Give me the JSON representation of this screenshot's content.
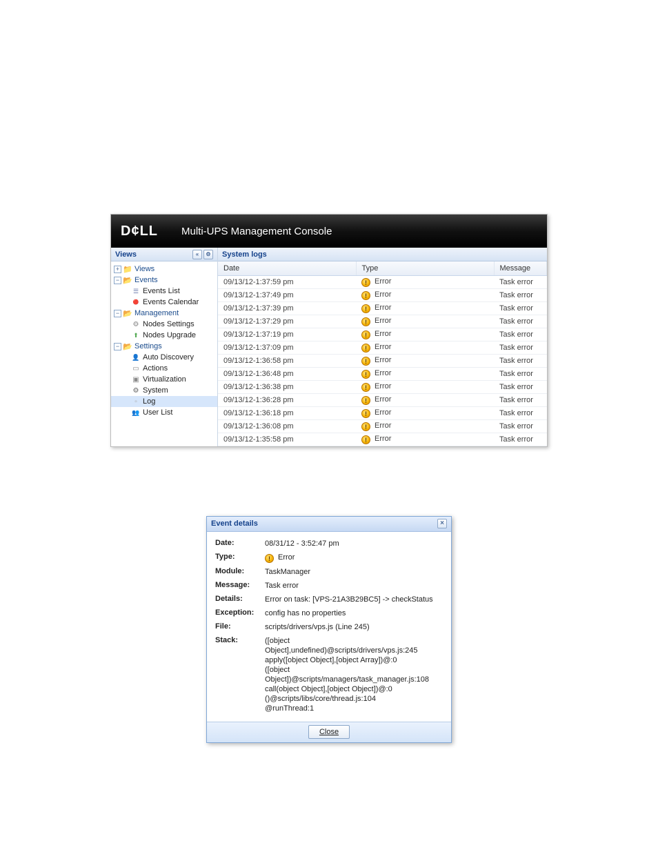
{
  "brand": {
    "logo": "D¢LL",
    "title": "Multi-UPS Management Console"
  },
  "sidebar": {
    "header": "Views",
    "nodes": [
      {
        "level": 0,
        "toggle": "+",
        "icon": "folder-closed",
        "label": "Views",
        "parent": true
      },
      {
        "level": 0,
        "toggle": "−",
        "icon": "folder-open",
        "label": "Events",
        "parent": true
      },
      {
        "level": 1,
        "toggle": "",
        "icon": "icon-list",
        "label": "Events List"
      },
      {
        "level": 1,
        "toggle": "",
        "icon": "icon-cal",
        "label": "Events Calendar"
      },
      {
        "level": 0,
        "toggle": "−",
        "icon": "folder-open",
        "label": "Management",
        "parent": true
      },
      {
        "level": 1,
        "toggle": "",
        "icon": "icon-node",
        "label": "Nodes Settings"
      },
      {
        "level": 1,
        "toggle": "",
        "icon": "icon-up",
        "label": "Nodes Upgrade"
      },
      {
        "level": 0,
        "toggle": "−",
        "icon": "folder-open",
        "label": "Settings",
        "parent": true
      },
      {
        "level": 1,
        "toggle": "",
        "icon": "icon-disc",
        "label": "Auto Discovery"
      },
      {
        "level": 1,
        "toggle": "",
        "icon": "icon-act",
        "label": "Actions"
      },
      {
        "level": 1,
        "toggle": "",
        "icon": "icon-virt",
        "label": "Virtualization"
      },
      {
        "level": 1,
        "toggle": "",
        "icon": "icon-sys",
        "label": "System"
      },
      {
        "level": 1,
        "toggle": "",
        "icon": "icon-log",
        "label": "Log",
        "selected": true
      },
      {
        "level": 1,
        "toggle": "",
        "icon": "icon-user",
        "label": "User List"
      }
    ]
  },
  "grid": {
    "title": "System logs",
    "columns": [
      "Date",
      "Type",
      "Message"
    ],
    "rows": [
      {
        "date": "09/13/12-1:37:59 pm",
        "type": "Error",
        "msg": "Task error"
      },
      {
        "date": "09/13/12-1:37:49 pm",
        "type": "Error",
        "msg": "Task error"
      },
      {
        "date": "09/13/12-1:37:39 pm",
        "type": "Error",
        "msg": "Task error"
      },
      {
        "date": "09/13/12-1:37:29 pm",
        "type": "Error",
        "msg": "Task error"
      },
      {
        "date": "09/13/12-1:37:19 pm",
        "type": "Error",
        "msg": "Task error"
      },
      {
        "date": "09/13/12-1:37:09 pm",
        "type": "Error",
        "msg": "Task error"
      },
      {
        "date": "09/13/12-1:36:58 pm",
        "type": "Error",
        "msg": "Task error"
      },
      {
        "date": "09/13/12-1:36:48 pm",
        "type": "Error",
        "msg": "Task error"
      },
      {
        "date": "09/13/12-1:36:38 pm",
        "type": "Error",
        "msg": "Task error"
      },
      {
        "date": "09/13/12-1:36:28 pm",
        "type": "Error",
        "msg": "Task error"
      },
      {
        "date": "09/13/12-1:36:18 pm",
        "type": "Error",
        "msg": "Task error"
      },
      {
        "date": "09/13/12-1:36:08 pm",
        "type": "Error",
        "msg": "Task error"
      },
      {
        "date": "09/13/12-1:35:58 pm",
        "type": "Error",
        "msg": "Task error"
      }
    ]
  },
  "dialog": {
    "title": "Event details",
    "fields": {
      "date_l": "Date:",
      "date_v": "08/31/12 - 3:52:47 pm",
      "type_l": "Type:",
      "type_v": "Error",
      "mod_l": "Module:",
      "mod_v": "TaskManager",
      "msg_l": "Message:",
      "msg_v": "Task error",
      "det_l": "Details:",
      "det_v": "Error on task: [VPS-21A3B29BC5] -> checkStatus",
      "exc_l": "Exception:",
      "exc_v": "config has no properties",
      "file_l": "File:",
      "file_v": "scripts/drivers/vps.js (Line 245)",
      "stk_l": "Stack:",
      "stk_v": "([object Object],undefined)@scripts/drivers/vps.js:245\napply([object Object],[object Array])@:0\n([object Object])@scripts/managers/task_manager.js:108\ncall(object Object],[object Object])@:0\n()@scripts/libs/core/thread.js:104\n@runThread:1"
    },
    "close": "Close"
  }
}
